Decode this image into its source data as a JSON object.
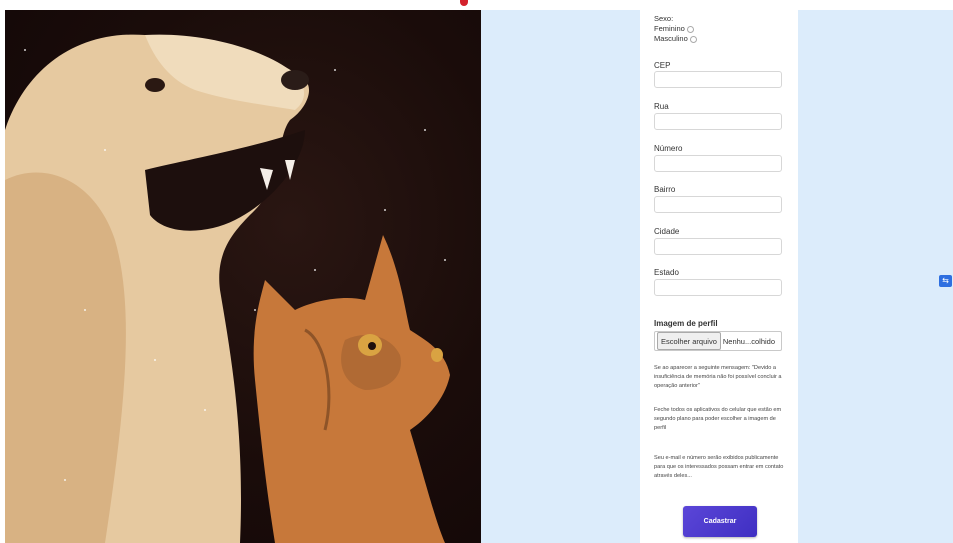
{
  "brand": {
    "accent": "#d3212c",
    "panel_bg": "#dcecfb",
    "button_color": "#4b3acf"
  },
  "photo": {
    "subject": "dog-and-cat-photo"
  },
  "form": {
    "sex": {
      "label": "Sexo:",
      "options": [
        "Feminino",
        "Masculino"
      ]
    },
    "fields": [
      {
        "label": "CEP",
        "value": ""
      },
      {
        "label": "Rua",
        "value": ""
      },
      {
        "label": "Número",
        "value": ""
      },
      {
        "label": "Bairro",
        "value": ""
      },
      {
        "label": "Cidade",
        "value": ""
      },
      {
        "label": "Estado",
        "value": ""
      }
    ],
    "profile_image": {
      "label": "Imagem de perfil",
      "button_label": "Escolher arquivo",
      "status": "Nenhu...colhido"
    },
    "notes": [
      "Se ao aparecer a seguinte mensagem: \"Devido a insuficiência de memória não foi possível concluir a operação anterior\"",
      "Feche todos os aplicativos do celular que estão em segundo plano para poder escolher a imagem de perfil",
      "Seu e-mail e número serão exibidos publicamente para que os interessados possam entrar em contato através deles..."
    ],
    "submit_label": "Cadastrar"
  },
  "side_icon": "translate-icon"
}
